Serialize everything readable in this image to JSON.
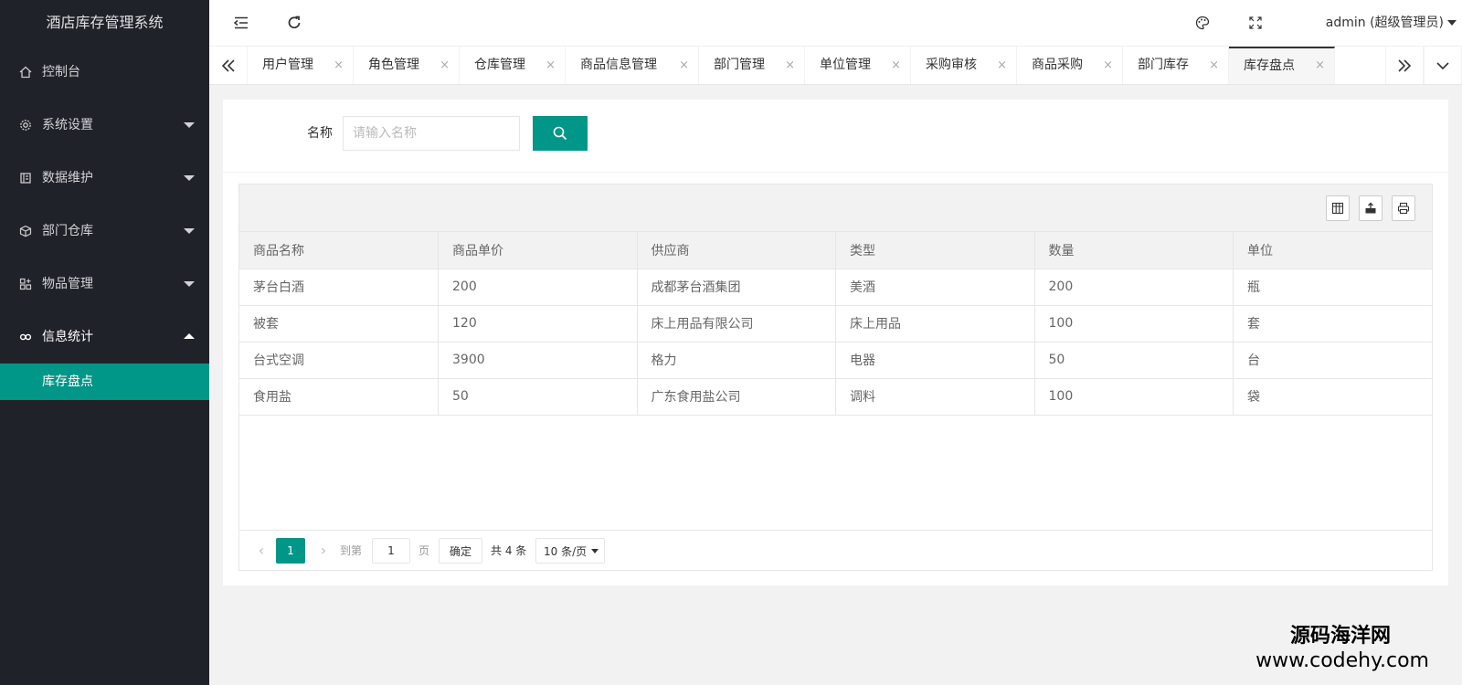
{
  "sidebar": {
    "logo": "酒店库存管理系统",
    "items": [
      {
        "label": "控制台",
        "icon": "home-icon"
      },
      {
        "label": "系统设置",
        "icon": "gear-icon"
      },
      {
        "label": "数据维护",
        "icon": "database-icon"
      },
      {
        "label": "部门仓库",
        "icon": "cube-icon"
      },
      {
        "label": "物品管理",
        "icon": "apps-icon"
      },
      {
        "label": "信息统计",
        "icon": "link-icon"
      }
    ],
    "active_child": "库存盘点"
  },
  "header": {
    "user": "admin (超级管理员)"
  },
  "tabs": {
    "items": [
      "用户管理",
      "角色管理",
      "仓库管理",
      "商品信息管理",
      "部门管理",
      "单位管理",
      "采购审核",
      "商品采购",
      "部门库存",
      "库存盘点"
    ],
    "active_index": 9,
    "close_glyph": "×"
  },
  "search": {
    "label": "名称",
    "placeholder": "请输入名称"
  },
  "table": {
    "headers": [
      "商品名称",
      "商品单价",
      "供应商",
      "类型",
      "数量",
      "单位"
    ],
    "rows": [
      [
        "茅台白酒",
        "200",
        "成都茅台酒集团",
        "美酒",
        "200",
        "瓶"
      ],
      [
        "被套",
        "120",
        "床上用品有限公司",
        "床上用品",
        "100",
        "套"
      ],
      [
        "台式空调",
        "3900",
        "格力",
        "电器",
        "50",
        "台"
      ],
      [
        "食用盐",
        "50",
        "广东食用盐公司",
        "调料",
        "100",
        "袋"
      ]
    ]
  },
  "pager": {
    "current": "1",
    "goto_label": "到第",
    "goto_value": "1",
    "page_label": "页",
    "confirm": "确定",
    "total": "共 4 条",
    "per_page": "10 条/页"
  },
  "watermark": {
    "line1": "源码海洋网",
    "line2": "www.codehy.com"
  },
  "colors": {
    "accent": "#009688",
    "sidebar_bg": "#20222a"
  }
}
